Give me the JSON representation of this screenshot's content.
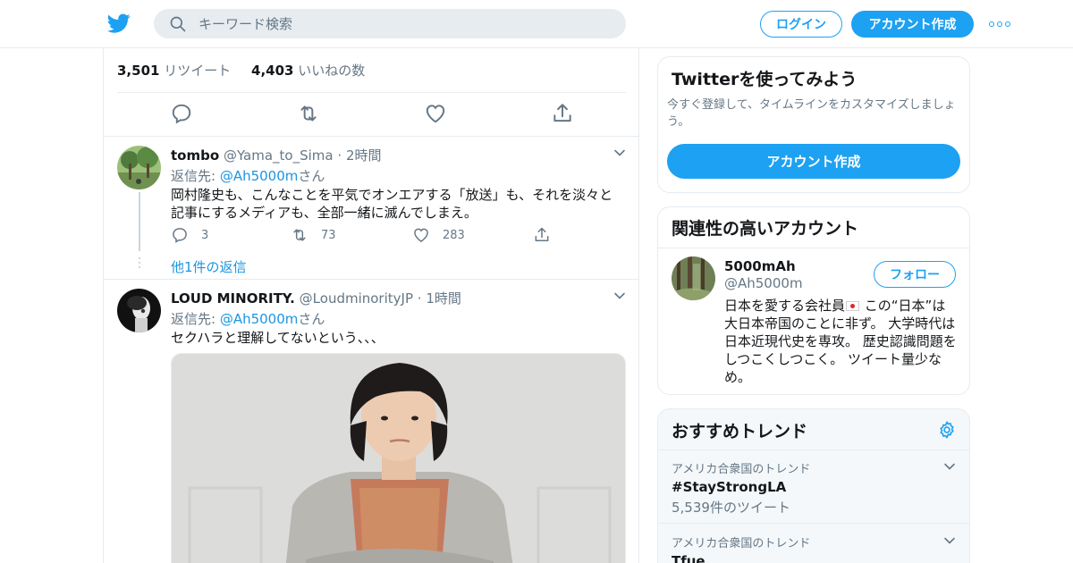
{
  "header": {
    "search_placeholder": "キーワード検索",
    "login_label": "ログイン",
    "signup_label": "アカウント作成"
  },
  "tweet_stats": {
    "retweets_count": "3,501",
    "retweets_label": "リツイート",
    "likes_count": "4,403",
    "likes_label": "いいねの数"
  },
  "replies": [
    {
      "name": "tombo",
      "handle": "@Yama_to_Sima",
      "time": "2時間",
      "reply_prefix": "返信先: ",
      "reply_to": "@Ah5000m",
      "reply_suffix": "さん",
      "text": "岡村隆史も、こんなことを平気でオンエアする「放送」も、それを淡々と記事にするメディアも、全部一緒に滅んでしまえ。",
      "reply_count": "3",
      "retweet_count": "73",
      "like_count": "283",
      "more_replies": "他1件の返信"
    },
    {
      "name": "LOUD MINORITY.",
      "handle": "@LoudminorityJP",
      "time": "1時間",
      "reply_prefix": "返信先: ",
      "reply_to": "@Ah5000m",
      "reply_suffix": "さん",
      "text": "セクハラと理解してないという、、、"
    }
  ],
  "sidebar": {
    "signup": {
      "title": "Twitterを使ってみよう",
      "description": "今すぐ登録して、タイムラインをカスタマイズしましょう。",
      "button": "アカウント作成"
    },
    "related": {
      "title": "関連性の高いアカウント",
      "name": "5000mAh",
      "handle": "@Ah5000m",
      "follow": "フォロー",
      "bio_before_flag": "日本を愛する会社員",
      "bio_after_flag": " この“日本”は大日本帝国のことに非ず。 大学時代は日本近現代史を専攻。 歴史認識問題をしつこくしつこく。 ツイート量少なめ。"
    },
    "trends": {
      "title": "おすすめトレンド",
      "items": [
        {
          "context": "アメリカ合衆国のトレンド",
          "name": "#StayStrongLA",
          "count": "5,539件のツイート"
        },
        {
          "context": "アメリカ合衆国のトレンド",
          "name": "Tfue"
        }
      ]
    }
  },
  "colors": {
    "brand": "#1da1f2",
    "link": "#1b95e0",
    "muted": "#657786",
    "text": "#14171a",
    "border": "#e6ecf0"
  },
  "icons": [
    "twitter-bird-icon",
    "search-icon",
    "more-icon",
    "reply-icon",
    "retweet-icon",
    "like-icon",
    "share-icon",
    "chevron-down-icon",
    "gear-icon"
  ]
}
